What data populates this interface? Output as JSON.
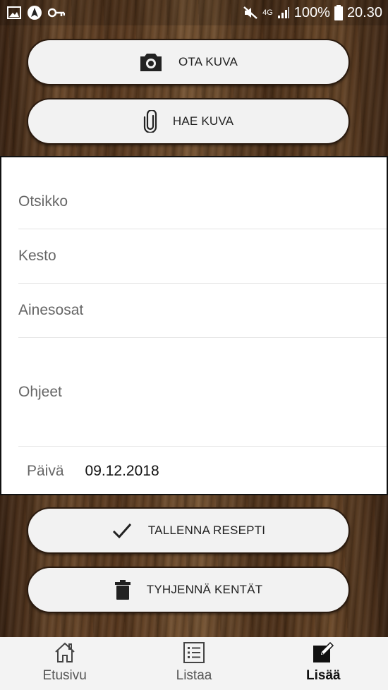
{
  "status_bar": {
    "left_icons": [
      "image-icon",
      "navigation-icon",
      "key-icon"
    ],
    "mute_icon": "mute-icon",
    "network": "4G",
    "battery": "100%",
    "time": "20.30"
  },
  "buttons": {
    "take_photo": {
      "label": "OTA KUVA",
      "icon": "camera-icon"
    },
    "fetch_photo": {
      "label": "HAE KUVA",
      "icon": "paperclip-icon"
    },
    "save": {
      "label": "TALLENNA RESEPTI",
      "icon": "check-icon"
    },
    "clear": {
      "label": "TYHJENNÄ KENTÄT",
      "icon": "trash-icon"
    }
  },
  "form": {
    "title_placeholder": "Otsikko",
    "duration_placeholder": "Kesto",
    "ingredients_placeholder": "Ainesosat",
    "instructions_placeholder": "Ohjeet",
    "date_label": "Päivä",
    "date_value": "09.12.2018"
  },
  "bottom_nav": [
    {
      "label": "Etusivu",
      "icon": "home-icon",
      "active": false
    },
    {
      "label": "Listaa",
      "icon": "list-icon",
      "active": false
    },
    {
      "label": "Lisää",
      "icon": "edit-icon",
      "active": true
    }
  ]
}
